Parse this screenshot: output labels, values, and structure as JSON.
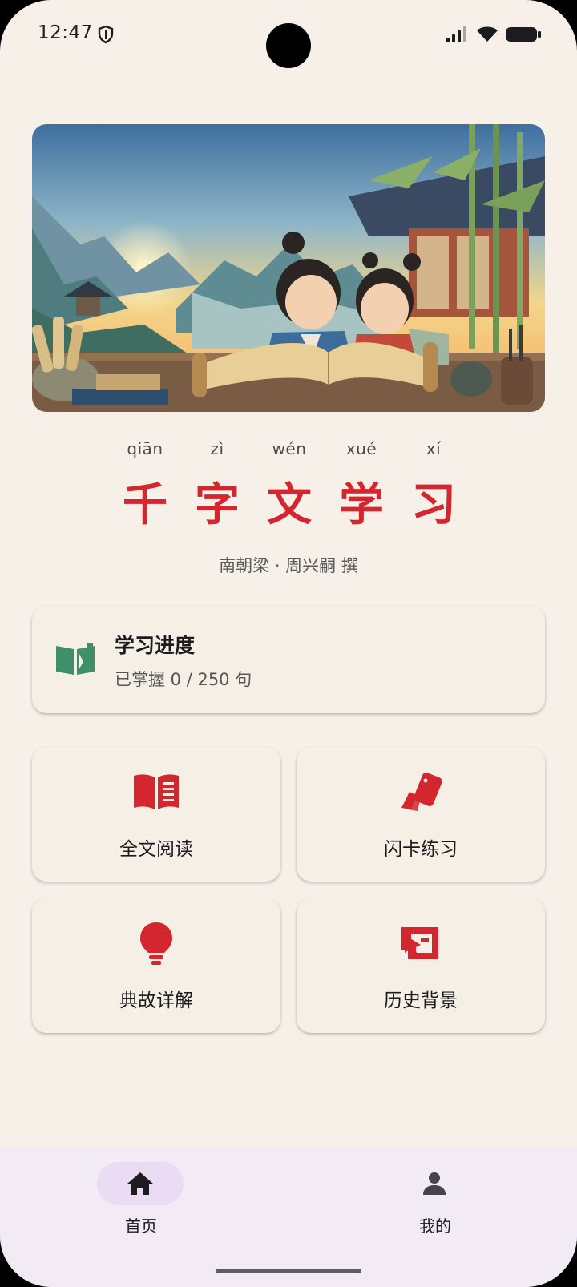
{
  "status_bar": {
    "time": "12:47"
  },
  "title": {
    "pinyin": [
      "qiān",
      "zì",
      "wén",
      "xué",
      "xí"
    ],
    "chars": [
      "千",
      "字",
      "文",
      "学",
      "习"
    ],
    "subtitle": "南朝梁 · 周兴嗣 撰"
  },
  "progress": {
    "title": "学习进度",
    "text": "已掌握 0 / 250 句",
    "icon": "open-book-icon"
  },
  "features": [
    {
      "label": "全文阅读",
      "icon": "book-icon"
    },
    {
      "label": "闪卡练习",
      "icon": "flashcards-icon"
    },
    {
      "label": "典故详解",
      "icon": "lightbulb-icon"
    },
    {
      "label": "历史背景",
      "icon": "history-icon"
    }
  ],
  "nav": [
    {
      "label": "首页",
      "icon": "home-icon",
      "selected": true
    },
    {
      "label": "我的",
      "icon": "person-icon",
      "selected": false
    }
  ],
  "colors": {
    "background": "#f6f0e8",
    "accent_red": "#d3262e",
    "accent_green": "#3f8f6a",
    "nav_background": "#f2ebf5",
    "nav_selected": "#e9dcf3"
  }
}
